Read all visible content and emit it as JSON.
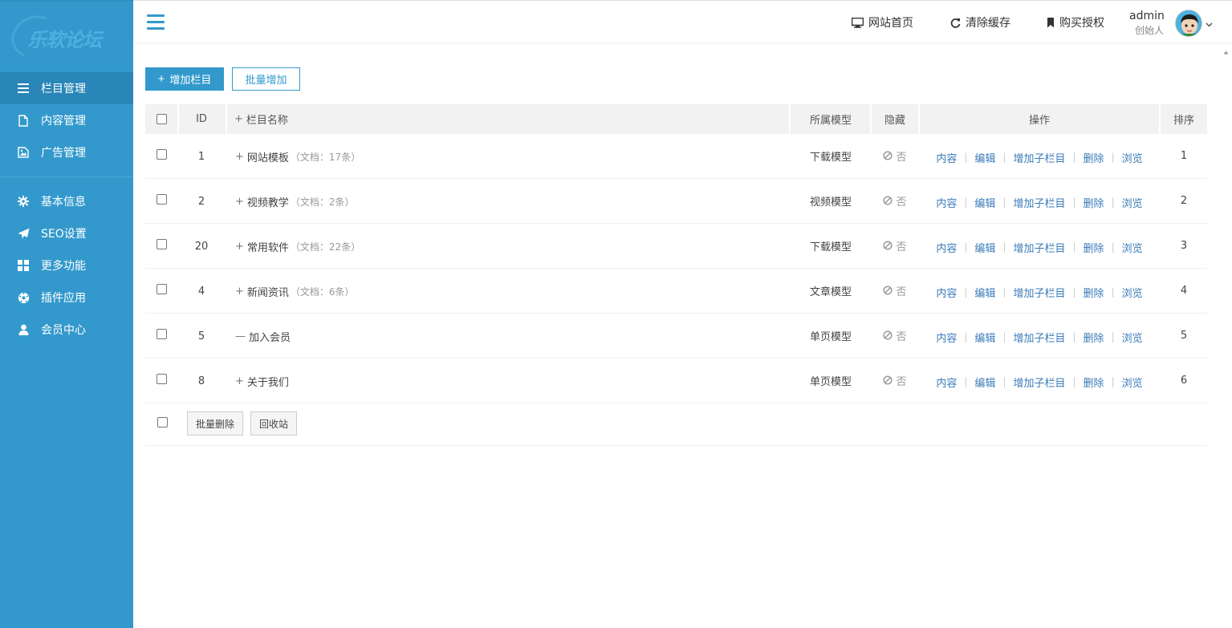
{
  "sidebar": {
    "logo_text": "乐软论坛",
    "items": [
      {
        "label": "栏目管理",
        "icon": "list-icon",
        "active": true
      },
      {
        "label": "内容管理",
        "icon": "file-icon"
      },
      {
        "label": "广告管理",
        "icon": "image-icon"
      },
      {
        "label": "基本信息",
        "icon": "gear-icon"
      },
      {
        "label": "SEO设置",
        "icon": "paper-plane-icon"
      },
      {
        "label": "更多功能",
        "icon": "grid-icon"
      },
      {
        "label": "插件应用",
        "icon": "soccer-ball-icon"
      },
      {
        "label": "会员中心",
        "icon": "user-icon"
      }
    ]
  },
  "topbar": {
    "site_home": "网站首页",
    "clear_cache": "清除缓存",
    "buy_license": "购买授权",
    "user_name": "admin",
    "user_role": "创始人"
  },
  "toolbar": {
    "add_label": "增加栏目",
    "batch_add_label": "批量增加"
  },
  "table": {
    "headers": {
      "id": "ID",
      "name": "栏目名称",
      "model": "所属模型",
      "hidden": "隐藏",
      "ops": "操作",
      "order": "排序"
    },
    "ops_labels": [
      "内容",
      "编辑",
      "增加子栏目",
      "删除",
      "浏览"
    ],
    "rows": [
      {
        "id": "1",
        "sign": "+",
        "name": "网站模板",
        "docs": "（文档：17条）",
        "model": "下载模型",
        "hidden": "否",
        "order": "1"
      },
      {
        "id": "2",
        "sign": "+",
        "name": "视频教学",
        "docs": "（文档：2条）",
        "model": "视频模型",
        "hidden": "否",
        "order": "2"
      },
      {
        "id": "20",
        "sign": "+",
        "name": "常用软件",
        "docs": "（文档：22条）",
        "model": "下载模型",
        "hidden": "否",
        "order": "3"
      },
      {
        "id": "4",
        "sign": "+",
        "name": "新闻资讯",
        "docs": "（文档：6条）",
        "model": "文章模型",
        "hidden": "否",
        "order": "4"
      },
      {
        "id": "5",
        "sign": "—",
        "name": "加入会员",
        "docs": "",
        "model": "单页模型",
        "hidden": "否",
        "order": "5"
      },
      {
        "id": "8",
        "sign": "+",
        "name": "关于我们",
        "docs": "",
        "model": "单页模型",
        "hidden": "否",
        "order": "6"
      }
    ],
    "footer": {
      "batch_delete": "批量删除",
      "recycle": "回收站"
    }
  },
  "colors": {
    "accent": "#3399cc",
    "link": "#3a7bb8"
  }
}
